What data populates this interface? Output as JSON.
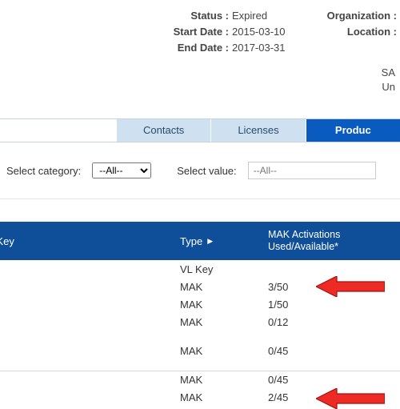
{
  "details": {
    "status_label": "Status :",
    "status_value": "Expired",
    "start_label": "Start Date :",
    "start_value": "2015-03-10",
    "end_label": "End Date :",
    "end_value": "2017-03-31",
    "org_label": "Organization :",
    "loc_label": "Location :",
    "extra_line1": "SA",
    "extra_line2": "Un"
  },
  "tabs": {
    "contacts": "Contacts",
    "licenses": "Licenses",
    "products": "Produc"
  },
  "filter": {
    "category_label": "Select category:",
    "category_option_all": "--All--",
    "value_label": "Select value:",
    "value_placeholder": "--All--"
  },
  "thead": {
    "key": "oduct Key",
    "type": "Type",
    "mak_line1": "MAK Activations",
    "mak_line2": "Used/Available*"
  },
  "rows": [
    {
      "type": "VL Key",
      "mak": ""
    },
    {
      "type": "MAK",
      "mak": "3/50"
    },
    {
      "type": "MAK",
      "mak": "1/50"
    },
    {
      "type": "MAK",
      "mak": "0/12"
    },
    {
      "type": "MAK",
      "mak": "0/45"
    },
    {
      "type": "MAK",
      "mak": "0/45"
    },
    {
      "type": "MAK",
      "mak": "2/45"
    }
  ],
  "colors": {
    "header_blue": "#0f4f9a",
    "tab_active": "#0a5bbf",
    "tab_inactive": "#cfe0f0",
    "arrow_red_fill": "#ed2b24",
    "arrow_red_stroke": "#a11310"
  }
}
